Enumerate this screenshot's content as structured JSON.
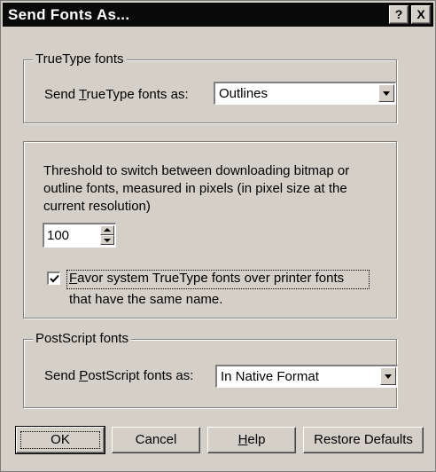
{
  "window": {
    "title": "Send Fonts As...",
    "help_button": "?",
    "close_button": "X"
  },
  "truetype_group": {
    "legend": "TrueType fonts",
    "label_pre": "Send ",
    "label_mnemonic": "T",
    "label_post": "rueType fonts as:",
    "selected": "Outlines"
  },
  "threshold_group": {
    "description_line1": "Threshold to switch between downloading bitmap or",
    "description_line2": "outline fonts, measured in pixels (in pixel size at the",
    "description_line3": "current resolution)",
    "spin_value": "100",
    "checkbox_checked": true,
    "checkbox_mnemonic": "F",
    "checkbox_line1_rest": "avor system TrueType fonts over printer fonts",
    "checkbox_line2": "that have the same name."
  },
  "postscript_group": {
    "legend": "PostScript fonts",
    "label_pre": "Send ",
    "label_mnemonic": "P",
    "label_post": "ostScript fonts as:",
    "selected": "In Native Format"
  },
  "buttons": {
    "ok": "OK",
    "cancel": "Cancel",
    "help_mnemonic": "H",
    "help_rest": "elp",
    "restore_defaults": "Restore Defaults"
  }
}
